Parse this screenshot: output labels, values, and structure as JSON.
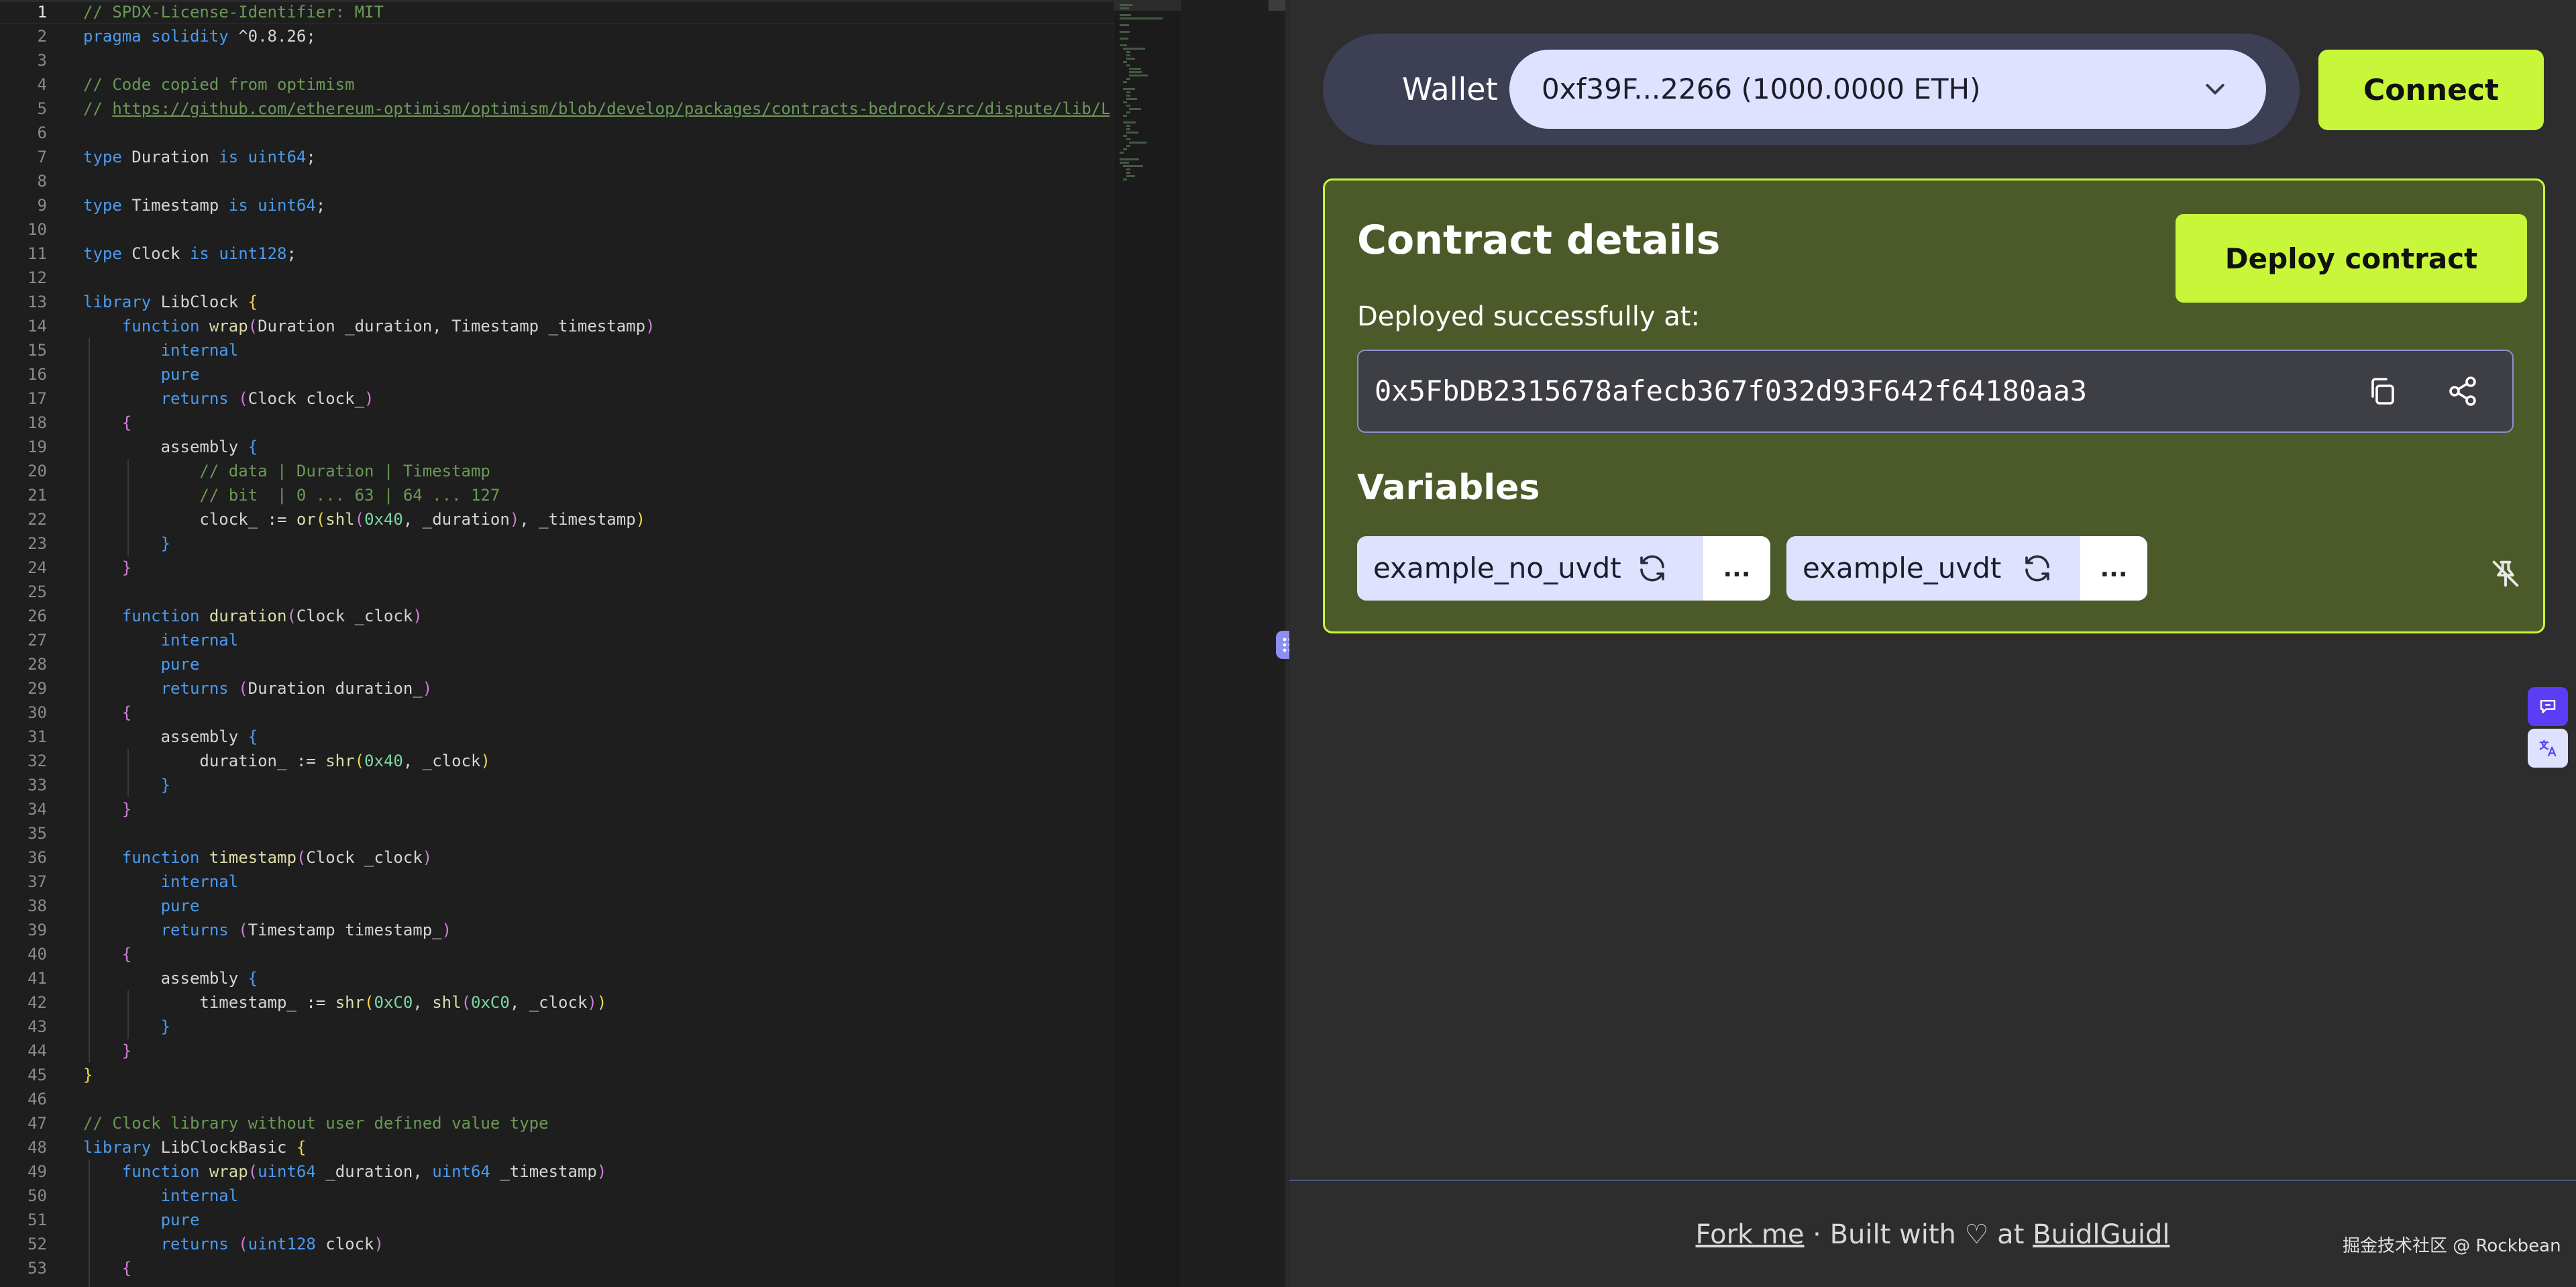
{
  "editor": {
    "lines": [
      {
        "n": "1",
        "tokens": [
          {
            "t": "// SPDX-License-Identifier: MIT",
            "c": "t-c"
          }
        ]
      },
      {
        "n": "2",
        "tokens": [
          {
            "t": "pragma solidity ",
            "c": "t-k"
          },
          {
            "t": "^0.8.26;",
            "c": ""
          }
        ]
      },
      {
        "n": "3",
        "tokens": []
      },
      {
        "n": "4",
        "tokens": [
          {
            "t": "// Code copied from optimism",
            "c": "t-c"
          }
        ]
      },
      {
        "n": "5",
        "tokens": [
          {
            "t": "// ",
            "c": "t-c"
          },
          {
            "t": "https://github.com/ethereum-optimism/optimism/blob/develop/packages/contracts-bedrock/src/dispute/lib/L",
            "c": "t-url"
          }
        ]
      },
      {
        "n": "6",
        "tokens": []
      },
      {
        "n": "7",
        "tokens": [
          {
            "t": "type ",
            "c": "t-k"
          },
          {
            "t": "Duration ",
            "c": ""
          },
          {
            "t": "is ",
            "c": "t-k"
          },
          {
            "t": "uint64",
            "c": "t-ty"
          },
          {
            "t": ";",
            "c": ""
          }
        ]
      },
      {
        "n": "8",
        "tokens": []
      },
      {
        "n": "9",
        "tokens": [
          {
            "t": "type ",
            "c": "t-k"
          },
          {
            "t": "Timestamp ",
            "c": ""
          },
          {
            "t": "is ",
            "c": "t-k"
          },
          {
            "t": "uint64",
            "c": "t-ty"
          },
          {
            "t": ";",
            "c": ""
          }
        ]
      },
      {
        "n": "10",
        "tokens": []
      },
      {
        "n": "11",
        "tokens": [
          {
            "t": "type ",
            "c": "t-k"
          },
          {
            "t": "Clock ",
            "c": ""
          },
          {
            "t": "is ",
            "c": "t-k"
          },
          {
            "t": "uint128",
            "c": "t-ty"
          },
          {
            "t": ";",
            "c": ""
          }
        ]
      },
      {
        "n": "12",
        "tokens": []
      },
      {
        "n": "13",
        "tokens": [
          {
            "t": "library ",
            "c": "t-k"
          },
          {
            "t": "LibClock ",
            "c": ""
          },
          {
            "t": "{",
            "c": "t-p1"
          }
        ]
      },
      {
        "n": "14",
        "tokens": [
          {
            "t": "    function ",
            "c": "t-k"
          },
          {
            "t": "wrap",
            "c": "t-f"
          },
          {
            "t": "(",
            "c": "t-p2"
          },
          {
            "t": "Duration _duration, Timestamp _timestamp",
            "c": ""
          },
          {
            "t": ")",
            "c": "t-p2"
          }
        ]
      },
      {
        "n": "15",
        "tokens": [
          {
            "t": "        internal",
            "c": "t-k"
          }
        ]
      },
      {
        "n": "16",
        "tokens": [
          {
            "t": "        pure",
            "c": "t-k"
          }
        ]
      },
      {
        "n": "17",
        "tokens": [
          {
            "t": "        returns ",
            "c": "t-k"
          },
          {
            "t": "(",
            "c": "t-p2"
          },
          {
            "t": "Clock clock_",
            "c": ""
          },
          {
            "t": ")",
            "c": "t-p2"
          }
        ]
      },
      {
        "n": "18",
        "tokens": [
          {
            "t": "    {",
            "c": "t-p2"
          }
        ]
      },
      {
        "n": "19",
        "tokens": [
          {
            "t": "        assembly ",
            "c": ""
          },
          {
            "t": "{",
            "c": "t-p3"
          }
        ]
      },
      {
        "n": "20",
        "tokens": [
          {
            "t": "            // data | Duration | Timestamp",
            "c": "t-c"
          }
        ]
      },
      {
        "n": "21",
        "tokens": [
          {
            "t": "            // bit  | 0 ... 63 | 64 ... 127",
            "c": "t-c"
          }
        ]
      },
      {
        "n": "22",
        "tokens": [
          {
            "t": "            clock_ := ",
            "c": ""
          },
          {
            "t": "or",
            "c": "t-f"
          },
          {
            "t": "(",
            "c": "t-p1"
          },
          {
            "t": "shl",
            "c": "t-f"
          },
          {
            "t": "(",
            "c": "t-p2"
          },
          {
            "t": "0x40",
            "c": "t-n"
          },
          {
            "t": ", _duration",
            "c": ""
          },
          {
            "t": ")",
            "c": "t-p2"
          },
          {
            "t": ", _timestamp",
            "c": ""
          },
          {
            "t": ")",
            "c": "t-p1"
          }
        ]
      },
      {
        "n": "23",
        "tokens": [
          {
            "t": "        }",
            "c": "t-p3"
          }
        ]
      },
      {
        "n": "24",
        "tokens": [
          {
            "t": "    }",
            "c": "t-p2"
          }
        ]
      },
      {
        "n": "25",
        "tokens": []
      },
      {
        "n": "26",
        "tokens": [
          {
            "t": "    function ",
            "c": "t-k"
          },
          {
            "t": "duration",
            "c": "t-f"
          },
          {
            "t": "(",
            "c": "t-p2"
          },
          {
            "t": "Clock _clock",
            "c": ""
          },
          {
            "t": ")",
            "c": "t-p2"
          }
        ]
      },
      {
        "n": "27",
        "tokens": [
          {
            "t": "        internal",
            "c": "t-k"
          }
        ]
      },
      {
        "n": "28",
        "tokens": [
          {
            "t": "        pure",
            "c": "t-k"
          }
        ]
      },
      {
        "n": "29",
        "tokens": [
          {
            "t": "        returns ",
            "c": "t-k"
          },
          {
            "t": "(",
            "c": "t-p2"
          },
          {
            "t": "Duration duration_",
            "c": ""
          },
          {
            "t": ")",
            "c": "t-p2"
          }
        ]
      },
      {
        "n": "30",
        "tokens": [
          {
            "t": "    {",
            "c": "t-p2"
          }
        ]
      },
      {
        "n": "31",
        "tokens": [
          {
            "t": "        assembly ",
            "c": ""
          },
          {
            "t": "{",
            "c": "t-p3"
          }
        ]
      },
      {
        "n": "32",
        "tokens": [
          {
            "t": "            duration_ := ",
            "c": ""
          },
          {
            "t": "shr",
            "c": "t-f"
          },
          {
            "t": "(",
            "c": "t-p1"
          },
          {
            "t": "0x40",
            "c": "t-n"
          },
          {
            "t": ", _clock",
            "c": ""
          },
          {
            "t": ")",
            "c": "t-p1"
          }
        ]
      },
      {
        "n": "33",
        "tokens": [
          {
            "t": "        }",
            "c": "t-p3"
          }
        ]
      },
      {
        "n": "34",
        "tokens": [
          {
            "t": "    }",
            "c": "t-p2"
          }
        ]
      },
      {
        "n": "35",
        "tokens": []
      },
      {
        "n": "36",
        "tokens": [
          {
            "t": "    function ",
            "c": "t-k"
          },
          {
            "t": "timestamp",
            "c": "t-f"
          },
          {
            "t": "(",
            "c": "t-p2"
          },
          {
            "t": "Clock _clock",
            "c": ""
          },
          {
            "t": ")",
            "c": "t-p2"
          }
        ]
      },
      {
        "n": "37",
        "tokens": [
          {
            "t": "        internal",
            "c": "t-k"
          }
        ]
      },
      {
        "n": "38",
        "tokens": [
          {
            "t": "        pure",
            "c": "t-k"
          }
        ]
      },
      {
        "n": "39",
        "tokens": [
          {
            "t": "        returns ",
            "c": "t-k"
          },
          {
            "t": "(",
            "c": "t-p2"
          },
          {
            "t": "Timestamp timestamp_",
            "c": ""
          },
          {
            "t": ")",
            "c": "t-p2"
          }
        ]
      },
      {
        "n": "40",
        "tokens": [
          {
            "t": "    {",
            "c": "t-p2"
          }
        ]
      },
      {
        "n": "41",
        "tokens": [
          {
            "t": "        assembly ",
            "c": ""
          },
          {
            "t": "{",
            "c": "t-p3"
          }
        ]
      },
      {
        "n": "42",
        "tokens": [
          {
            "t": "            timestamp_ := ",
            "c": ""
          },
          {
            "t": "shr",
            "c": "t-f"
          },
          {
            "t": "(",
            "c": "t-p1"
          },
          {
            "t": "0xC0",
            "c": "t-n"
          },
          {
            "t": ", ",
            "c": ""
          },
          {
            "t": "shl",
            "c": "t-f"
          },
          {
            "t": "(",
            "c": "t-p2"
          },
          {
            "t": "0xC0",
            "c": "t-n"
          },
          {
            "t": ", _clock",
            "c": ""
          },
          {
            "t": ")",
            "c": "t-p2"
          },
          {
            "t": ")",
            "c": "t-p1"
          }
        ]
      },
      {
        "n": "43",
        "tokens": [
          {
            "t": "        }",
            "c": "t-p3"
          }
        ]
      },
      {
        "n": "44",
        "tokens": [
          {
            "t": "    }",
            "c": "t-p2"
          }
        ]
      },
      {
        "n": "45",
        "tokens": [
          {
            "t": "}",
            "c": "t-p1"
          }
        ]
      },
      {
        "n": "46",
        "tokens": []
      },
      {
        "n": "47",
        "tokens": [
          {
            "t": "// Clock library without user defined value type",
            "c": "t-c"
          }
        ]
      },
      {
        "n": "48",
        "tokens": [
          {
            "t": "library ",
            "c": "t-k"
          },
          {
            "t": "LibClockBasic ",
            "c": ""
          },
          {
            "t": "{",
            "c": "t-p1"
          }
        ]
      },
      {
        "n": "49",
        "tokens": [
          {
            "t": "    function ",
            "c": "t-k"
          },
          {
            "t": "wrap",
            "c": "t-f"
          },
          {
            "t": "(",
            "c": "t-p2"
          },
          {
            "t": "uint64",
            "c": "t-ty"
          },
          {
            "t": " _duration, ",
            "c": ""
          },
          {
            "t": "uint64",
            "c": "t-ty"
          },
          {
            "t": " _timestamp",
            "c": ""
          },
          {
            "t": ")",
            "c": "t-p2"
          }
        ]
      },
      {
        "n": "50",
        "tokens": [
          {
            "t": "        internal",
            "c": "t-k"
          }
        ]
      },
      {
        "n": "51",
        "tokens": [
          {
            "t": "        pure",
            "c": "t-k"
          }
        ]
      },
      {
        "n": "52",
        "tokens": [
          {
            "t": "        returns ",
            "c": "t-k"
          },
          {
            "t": "(",
            "c": "t-p2"
          },
          {
            "t": "uint128",
            "c": "t-ty"
          },
          {
            "t": " clock",
            "c": ""
          },
          {
            "t": ")",
            "c": "t-p2"
          }
        ]
      },
      {
        "n": "53",
        "tokens": [
          {
            "t": "    {",
            "c": "t-p2"
          }
        ]
      }
    ]
  },
  "wallet": {
    "label": "Wallet",
    "selected": "0xf39F...2266 (1000.0000 ETH)",
    "connect_label": "Connect"
  },
  "contract": {
    "title": "Contract details",
    "deploy_label": "Deploy contract",
    "deployed_label": "Deployed successfully at:",
    "address": "0x5FbDB2315678afecb367f032d93F642f64180aa3",
    "variables_title": "Variables",
    "variables": [
      {
        "name": "example_no_uvdt",
        "more": "..."
      },
      {
        "name": "example_uvdt",
        "more": "..."
      }
    ]
  },
  "footer": {
    "fork": "Fork me",
    "sep": " · Built with ♡ at ",
    "buidl": "BuidlGuidl"
  },
  "watermark": "掘金技术社区 @ Rockbean",
  "colors": {
    "accent": "#c8f73a",
    "card": "#4c5a29",
    "chip": "#dfe2ff",
    "wallet_bar": "#3d3f55"
  },
  "icons": {
    "copy": "copy-icon",
    "share": "share-icon",
    "refresh": "refresh-icon",
    "pin": "pin-off-icon",
    "chevron": "chevron-down-icon",
    "drag": "drag-handle-icon"
  }
}
